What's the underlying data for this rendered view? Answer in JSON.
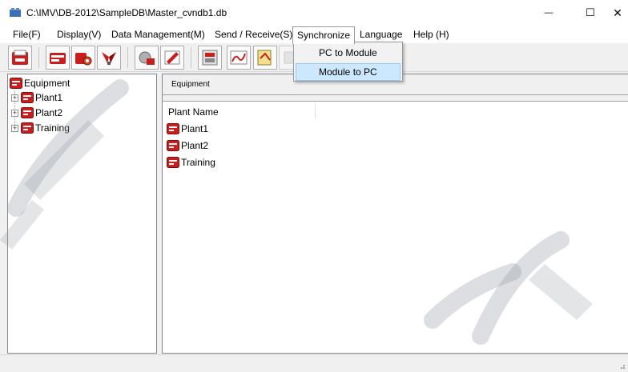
{
  "window": {
    "title": "C:\\IMV\\DB-2012\\SampleDB\\Master_cvndb1.db",
    "minimize_glyph": "—",
    "maximize_glyph": "☐",
    "close_glyph": "✕"
  },
  "menubar": {
    "items": [
      {
        "label": "File(F)"
      },
      {
        "label": "Display(V)"
      },
      {
        "label": "Data Management(M)"
      },
      {
        "label": "Send / Receive(S)"
      },
      {
        "label": "Synchronize"
      },
      {
        "label": "Language"
      },
      {
        "label": "Help (H)"
      }
    ],
    "open_menu": "Synchronize"
  },
  "dropdown": {
    "items": [
      {
        "label": "PC to Module",
        "highlighted": false
      },
      {
        "label": "Module to PC",
        "highlighted": true
      }
    ]
  },
  "toolbar": {
    "buttons": [
      {
        "icon": "open-database-icon"
      },
      {
        "icon": "equipment-icon"
      },
      {
        "icon": "maintenance-icon"
      },
      {
        "icon": "tools-icon"
      },
      {
        "icon": "measurement-icon"
      },
      {
        "icon": "edit-icon"
      },
      {
        "icon": "module-icon"
      },
      {
        "icon": "graph-icon"
      },
      {
        "icon": "report-icon"
      },
      {
        "icon": "disabled-icon"
      }
    ]
  },
  "tree": {
    "root": {
      "label": "Equipment",
      "icon": "equipment-icon"
    },
    "children": [
      {
        "label": "Plant1",
        "expander": "+",
        "icon": "equipment-icon"
      },
      {
        "label": "Plant2",
        "expander": "+",
        "icon": "equipment-icon"
      },
      {
        "label": "Training",
        "expander": "+",
        "icon": "equipment-icon"
      }
    ]
  },
  "right_panel": {
    "header": "Equipment",
    "column_header": "Plant Name",
    "rows": [
      {
        "label": "Plant1",
        "icon": "equipment-icon"
      },
      {
        "label": "Plant2",
        "icon": "equipment-icon"
      },
      {
        "label": "Training",
        "icon": "equipment-icon"
      }
    ]
  },
  "colors": {
    "accent_red": "#c81e1e",
    "hover_blue": "#cce8ff",
    "hover_border": "#99c7ef",
    "watermark": "#9aa0a8"
  }
}
